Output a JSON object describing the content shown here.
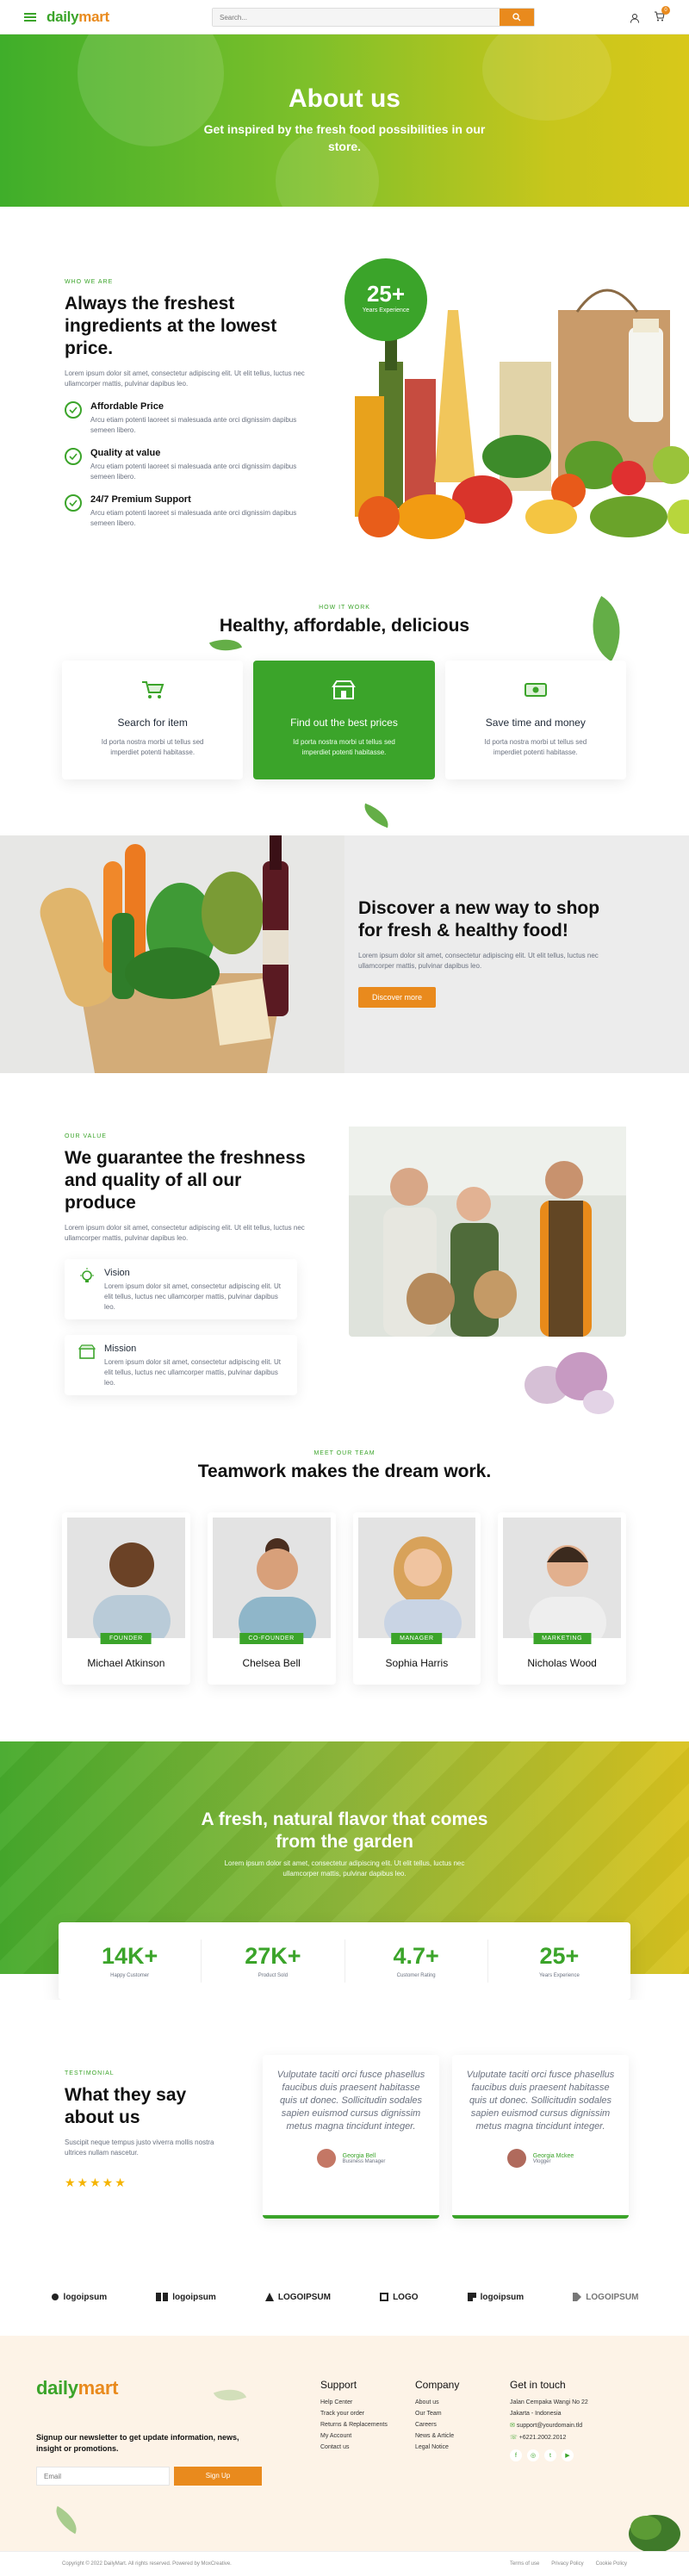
{
  "header": {
    "logo_main": "daily",
    "logo_accent": "mart",
    "search_placeholder": "Search...",
    "cart_count": "0"
  },
  "hero": {
    "title": "About us",
    "subtitle": "Get inspired by the fresh food possibilities in our store."
  },
  "intro": {
    "tag": "WHO WE ARE",
    "title": "Always the freshest ingredients at the lowest price.",
    "text": "Lorem ipsum dolor sit amet, consectetur adipiscing elit. Ut elit tellus, luctus nec ullamcorper mattis, pulvinar dapibus leo.",
    "badge_number": "25+",
    "badge_label": "Years Experience",
    "features": [
      {
        "title": "Affordable Price",
        "text": "Arcu etiam potenti laoreet si malesuada ante orci dignissim dapibus semeen libero."
      },
      {
        "title": "Quality at value",
        "text": "Arcu etiam potenti laoreet si malesuada ante orci dignissim dapibus semeen libero."
      },
      {
        "title": "24/7 Premium Support",
        "text": "Arcu etiam potenti laoreet si malesuada ante orci dignissim dapibus semeen libero."
      }
    ]
  },
  "how": {
    "tag": "HOW IT WORK",
    "title": "Healthy, affordable, delicious",
    "cards": [
      {
        "title": "Search for item",
        "text": "Id porta nostra morbi ut tellus sed imperdiet potenti habitasse."
      },
      {
        "title": "Find out the best prices",
        "text": "Id porta nostra morbi ut tellus sed imperdiet potenti habitasse."
      },
      {
        "title": "Save time and money",
        "text": "Id porta nostra morbi ut tellus sed imperdiet potenti habitasse."
      }
    ]
  },
  "discover": {
    "title": "Discover a new way to shop for fresh & healthy food!",
    "text": "Lorem ipsum dolor sit amet, consectetur adipiscing elit. Ut elit tellus, luctus nec ullamcorper mattis, pulvinar dapibus leo.",
    "button": "Discover more"
  },
  "value": {
    "tag": "OUR VALUE",
    "title": "We guarantee the freshness and quality of all our produce",
    "text": "Lorem ipsum dolor sit amet, consectetur adipiscing elit. Ut elit tellus, luctus nec ullamcorper mattis, pulvinar dapibus leo.",
    "vision_title": "Vision",
    "vision_text": "Lorem ipsum dolor sit amet, consectetur adipiscing elit. Ut elit tellus, luctus nec ullamcorper mattis, pulvinar dapibus leo.",
    "mission_title": "Mission",
    "mission_text": "Lorem ipsum dolor sit amet, consectetur adipiscing elit. Ut elit tellus, luctus nec ullamcorper mattis, pulvinar dapibus leo."
  },
  "team": {
    "tag": "MEET OUR TEAM",
    "title": "Teamwork makes the dream work.",
    "members": [
      {
        "name": "Michael Atkinson",
        "role": "FOUNDER"
      },
      {
        "name": "Chelsea Bell",
        "role": "CO-FOUNDER"
      },
      {
        "name": "Sophia Harris",
        "role": "MANAGER"
      },
      {
        "name": "Nicholas Wood",
        "role": "MARKETING"
      }
    ]
  },
  "flavor": {
    "title": "A fresh, natural flavor that comes from the garden",
    "text": "Lorem ipsum dolor sit amet, consectetur adipiscing elit. Ut elit tellus, luctus nec ullamcorper mattis, pulvinar dapibus leo."
  },
  "stats": [
    {
      "number": "14K+",
      "label": "Happy Customer"
    },
    {
      "number": "27K+",
      "label": "Product Sold"
    },
    {
      "number": "4.7+",
      "label": "Customer Rating"
    },
    {
      "number": "25+",
      "label": "Years Experience"
    }
  ],
  "testimonial": {
    "tag": "TESTIMONIAL",
    "title": "What they say about us",
    "text": "Suscipit neque tempus justo viverra mollis nostra ultrices nullam nascetur.",
    "stars": "★★★★★",
    "quotes": [
      {
        "text": "Vulputate taciti orci fusce phasellus faucibus duis praesent habitasse quis ut donec. Sollicitudin sodales sapien euismod cursus dignissim metus magna tincidunt integer.",
        "name": "Georgia Bell",
        "role": "Business Manager"
      },
      {
        "text": "Vulputate taciti orci fusce phasellus faucibus duis praesent habitasse quis ut donec. Sollicitudin sodales sapien euismod cursus dignissim metus magna tincidunt integer.",
        "name": "Georgia Mckee",
        "role": "Vlogger"
      }
    ]
  },
  "logos": [
    "logoipsum",
    "logoipsum",
    "LOGOIPSUM",
    "LOGO",
    "logoipsum",
    "LOGOIPSUM"
  ],
  "footer": {
    "newsletter": "Signup our newsletter to get update information, news, insight or promotions.",
    "email_placeholder": "Email",
    "signup": "Sign Up",
    "support_title": "Support",
    "support_links": [
      "Help Center",
      "Track your order",
      "Returns & Replacements",
      "My Account",
      "Contact us"
    ],
    "company_title": "Company",
    "company_links": [
      "About us",
      "Our Team",
      "Careers",
      "News & Article",
      "Legal Notice"
    ],
    "contact_title": "Get in touch",
    "address1": "Jalan Cempaka Wangi No 22",
    "address2": "Jakarta - Indonesia",
    "email": "support@yourdomain.tld",
    "phone": "+6221.2002.2012",
    "copyright": "Copyright © 2022 DailyMart. All rights reserved. Powered by MoxCreative.",
    "bottom_links": [
      "Terms of use",
      "Privacy Policy",
      "Cookie Policy"
    ]
  },
  "colors": {
    "primary": "#3ba42a",
    "accent": "#e98a1d"
  }
}
